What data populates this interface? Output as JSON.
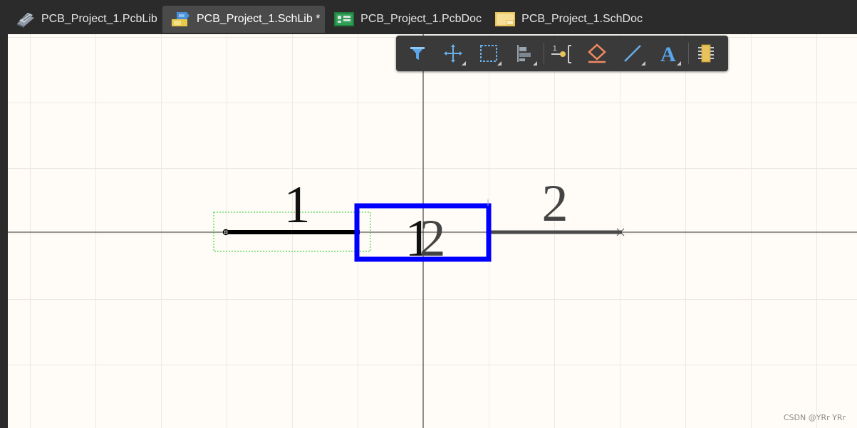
{
  "tabs": [
    {
      "label": "PCB_Project_1.PcbLib",
      "icon": "pcb-library-icon",
      "active": false
    },
    {
      "label": "PCB_Project_1.SchLib *",
      "icon": "schematic-library-icon",
      "active": true
    },
    {
      "label": "PCB_Project_1.PcbDoc",
      "icon": "pcb-document-icon",
      "active": false
    },
    {
      "label": "PCB_Project_1.SchDoc",
      "icon": "schematic-document-icon",
      "active": false
    }
  ],
  "toolbar": {
    "tools": [
      "filter-icon",
      "move-icon",
      "select-rectangle-icon",
      "align-icon",
      "place-pin-icon",
      "place-ieee-symbol-icon",
      "place-line-icon",
      "place-text-icon",
      "component-icon"
    ]
  },
  "component": {
    "pin1_designator": "1",
    "pin2_designator": "2",
    "body_overlap_left": "1",
    "body_overlap_right": "2",
    "body_color": "#0000ff",
    "selection_color": "#00cc00"
  },
  "colors": {
    "canvas_bg": "#fffcf7",
    "grid": "#ece8e0",
    "tabbar_bg": "#2b2b2b",
    "active_tab_bg": "#4a4a4a",
    "toolbar_bg": "#3a3a3a"
  },
  "watermark": "CSDN @YRr YRr"
}
